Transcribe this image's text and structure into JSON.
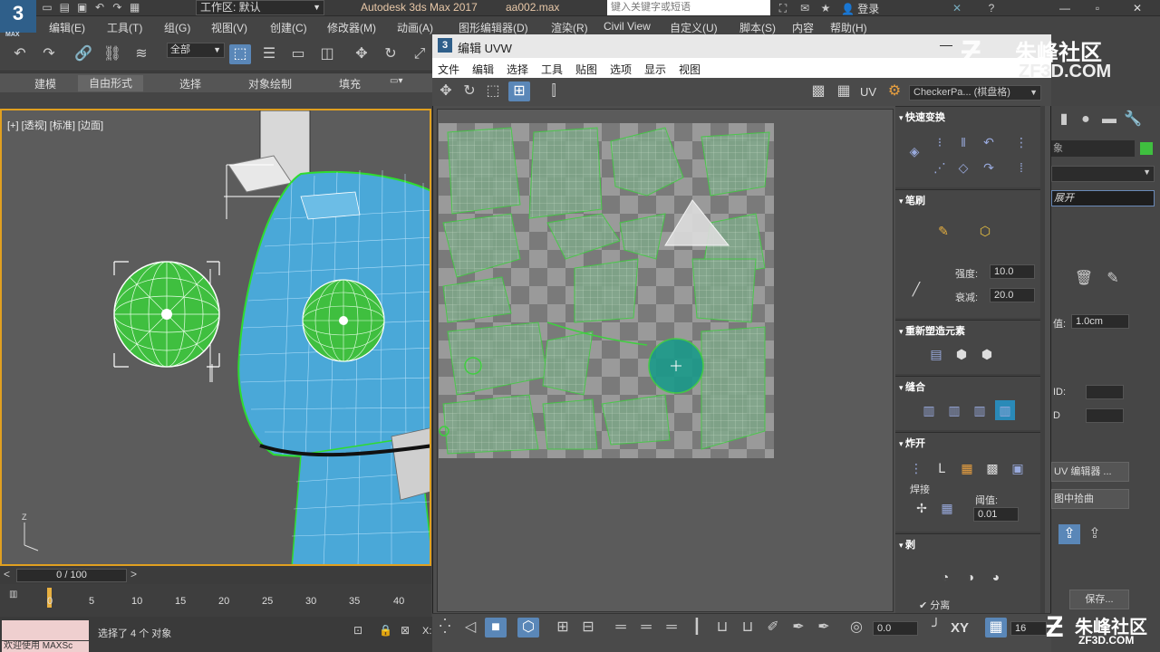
{
  "app": {
    "logo": "3",
    "logo_sub": "MAX",
    "workspace_label": "工作区: 默认",
    "title": "Autodesk 3ds Max 2017",
    "filename": "aa002.max",
    "search_placeholder": "键入关键字或短语",
    "login": "登录"
  },
  "menubar": [
    "编辑(E)",
    "工具(T)",
    "组(G)",
    "视图(V)",
    "创建(C)",
    "修改器(M)",
    "动画(A)",
    "图形编辑器(D)",
    "渲染(R)",
    "Civil View",
    "自定义(U)",
    "脚本(S)",
    "内容",
    "帮助(H)"
  ],
  "toolbar": {
    "selection_filter": "全部"
  },
  "ribbon": {
    "tabs": [
      "建模",
      "自由形式",
      "选择",
      "对象绘制",
      "填充"
    ],
    "active": "自由形式"
  },
  "viewport": {
    "label": "[+] [透视] [标准] [边面]"
  },
  "timeline": {
    "frame": "0 / 100",
    "ticks": [
      "0",
      "5",
      "10",
      "15",
      "20",
      "25",
      "30",
      "35",
      "40"
    ]
  },
  "status": {
    "maxscript": "欢迎使用 MAXSc",
    "maxscript2": "",
    "selection": "选择了 4 个 对象",
    "x_label": "X:"
  },
  "uvw": {
    "title": "编辑 UVW",
    "menu": [
      "文件",
      "编辑",
      "选择",
      "工具",
      "贴图",
      "选项",
      "显示",
      "视图"
    ],
    "uv_label": "UV",
    "texture": "CheckerPa... (棋盘格)"
  },
  "panel": {
    "quick_transform": "快速变换",
    "brush": "笔刷",
    "strength_label": "强度:",
    "strength_value": "10.0",
    "falloff_label": "衰减:",
    "falloff_value": "20.0",
    "reshape": "重新塑造元素",
    "stitch": "缝合",
    "explode": "炸开",
    "weld_label": "焊接",
    "threshold_label": "阈值:",
    "threshold_value": "0.01",
    "peel": "剥",
    "detach_label": "分离"
  },
  "uvbottom": {
    "rotation_value": "0.0",
    "xy_label": "XY",
    "grid_value": "16"
  },
  "cmdpanel": {
    "object_label": "象",
    "modifier_item": "展开",
    "value_label": "值:",
    "value": "1.0cm",
    "id_label": "ID:",
    "d_label": "D",
    "editor_button": "UV 编辑器 ...",
    "pick_button": "图中拾曲",
    "save_button": "保存..."
  },
  "watermark": {
    "brand": "朱峰社区",
    "site": "ZF3D.COM"
  },
  "colors": {
    "accent": "#5a87b8",
    "viewport_border": "#e0a020",
    "mesh_blue": "#4aa8d8",
    "uv_green": "#3fcf3f"
  }
}
